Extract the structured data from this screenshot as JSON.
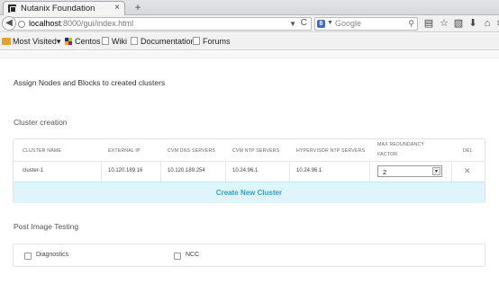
{
  "browser": {
    "tab_title": "Nutanix Foundation",
    "tab_close": "×",
    "new_tab": "+",
    "url_host": "localhost",
    "url_path": ":8000/gui/index.html",
    "search_placeholder": "Google",
    "search_engine_letter": "8",
    "reload": "C",
    "icons": [
      "bookmark-list-icon",
      "star-icon",
      "reading-list-icon",
      "download-icon",
      "home-icon",
      "menu-icon"
    ],
    "bookmarks": [
      {
        "label": "Most Visited",
        "type": "folder"
      },
      {
        "label": "Centos",
        "type": "centos"
      },
      {
        "label": "Wiki",
        "type": "page"
      },
      {
        "label": "Documentation",
        "type": "page"
      },
      {
        "label": "Forums",
        "type": "page"
      }
    ]
  },
  "page": {
    "intro": "Assign Nodes and Blocks to created clusters",
    "cluster_section_title": "Cluster creation",
    "post_section_title": "Post Image Testing"
  },
  "cluster_table": {
    "headers": {
      "name": "CLUSTER NAME",
      "external_ip": "EXTERNAL IP",
      "dns": "CVM DNS SERVERS",
      "ntp": "CVM NTP SERVERS",
      "hyp_ntp": "HYPERVISOR NTP SERVERS",
      "max_rf_line1": "MAX REDUNDANCY",
      "max_rf_line2": "FACTOR",
      "del": "DEL"
    },
    "rows": [
      {
        "name": "cluster-1",
        "external_ip": "10.120.189.16",
        "dns": "10.120.189.254",
        "ntp": "10.24.96.1",
        "hyp_ntp": "10.24.96.1",
        "max_rf": "2"
      }
    ],
    "create_button": "Create New Cluster"
  },
  "post_tests": [
    {
      "label": "Diagnostics",
      "checked": false
    },
    {
      "label": "NCC",
      "checked": false
    }
  ],
  "colors": {
    "accent": "#3a9fc4",
    "create_bar_bg": "#dff4fb"
  }
}
